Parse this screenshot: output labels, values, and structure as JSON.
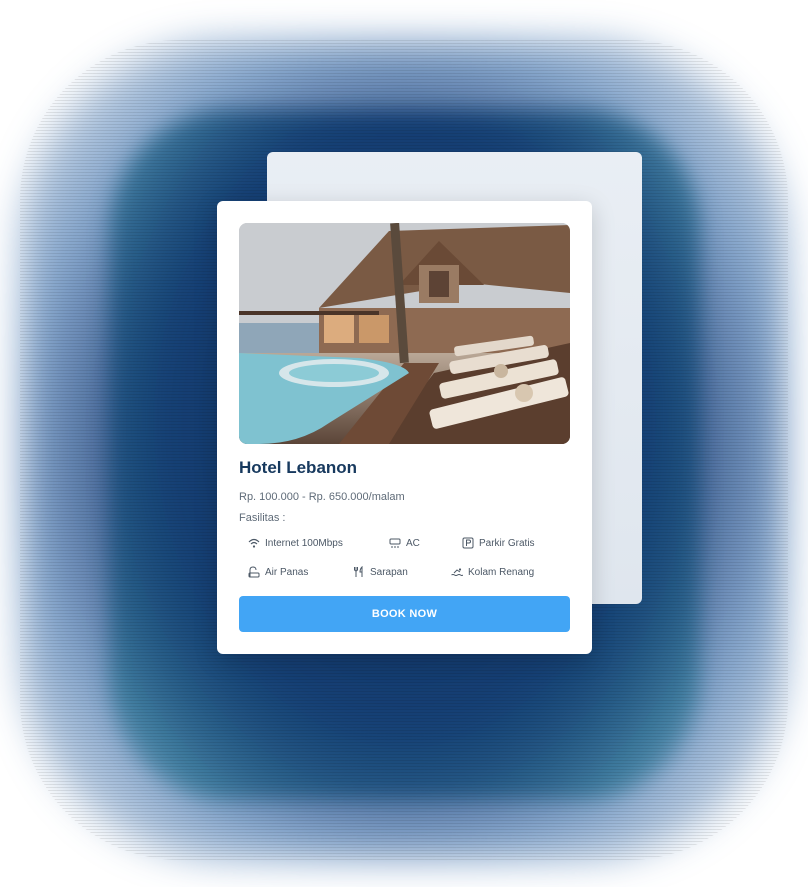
{
  "hotel": {
    "name": "Hotel Lebanon",
    "price": "Rp. 100.000 - Rp. 650.000/malam",
    "facilities_label": "Fasilitas :",
    "facilities": [
      {
        "label": "Internet 100Mbps",
        "icon": "wifi-icon"
      },
      {
        "label": "AC",
        "icon": "ac-icon"
      },
      {
        "label": "Parkir Gratis",
        "icon": "parking-icon"
      },
      {
        "label": "Air Panas",
        "icon": "hot-water-icon"
      },
      {
        "label": "Sarapan",
        "icon": "cutlery-icon"
      },
      {
        "label": "Kolam Renang",
        "icon": "swimming-icon"
      }
    ],
    "cta": "BOOK NOW"
  },
  "colors": {
    "accent": "#42a5f5",
    "title": "#17395e",
    "backdrop": "#153f74"
  }
}
